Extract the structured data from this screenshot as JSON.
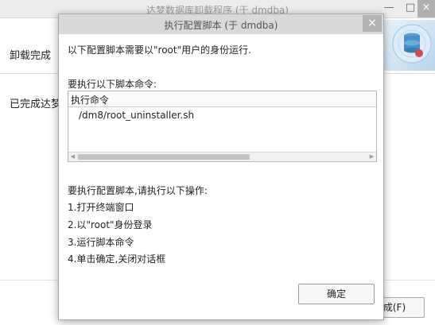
{
  "background_window": {
    "title": "达梦数据库卸载程序 (于 dmdba)",
    "controls": {
      "minimize": "—",
      "maximize": "□",
      "close": "×"
    },
    "header_title": "卸载完成",
    "side_text": "已完成达梦",
    "finish_button": "完成(F)"
  },
  "dialog": {
    "title": "执行配置脚本 (于 dmdba)",
    "close_glyph": "×",
    "intro": "以下配置脚本需要以\"root\"用户的身份运行.",
    "command_heading": "要执行以下脚本命令:",
    "table": {
      "column_header": "执行命令",
      "rows": [
        "/dm8/root_uninstaller.sh"
      ]
    },
    "steps_heading": "要执行配置脚本,请执行以下操作:",
    "steps": [
      "1.打开终端窗口",
      "2.以\"root\"身份登录",
      "3.运行脚本命令",
      "4.单击确定,关闭对话框"
    ],
    "ok_button": "确定"
  }
}
